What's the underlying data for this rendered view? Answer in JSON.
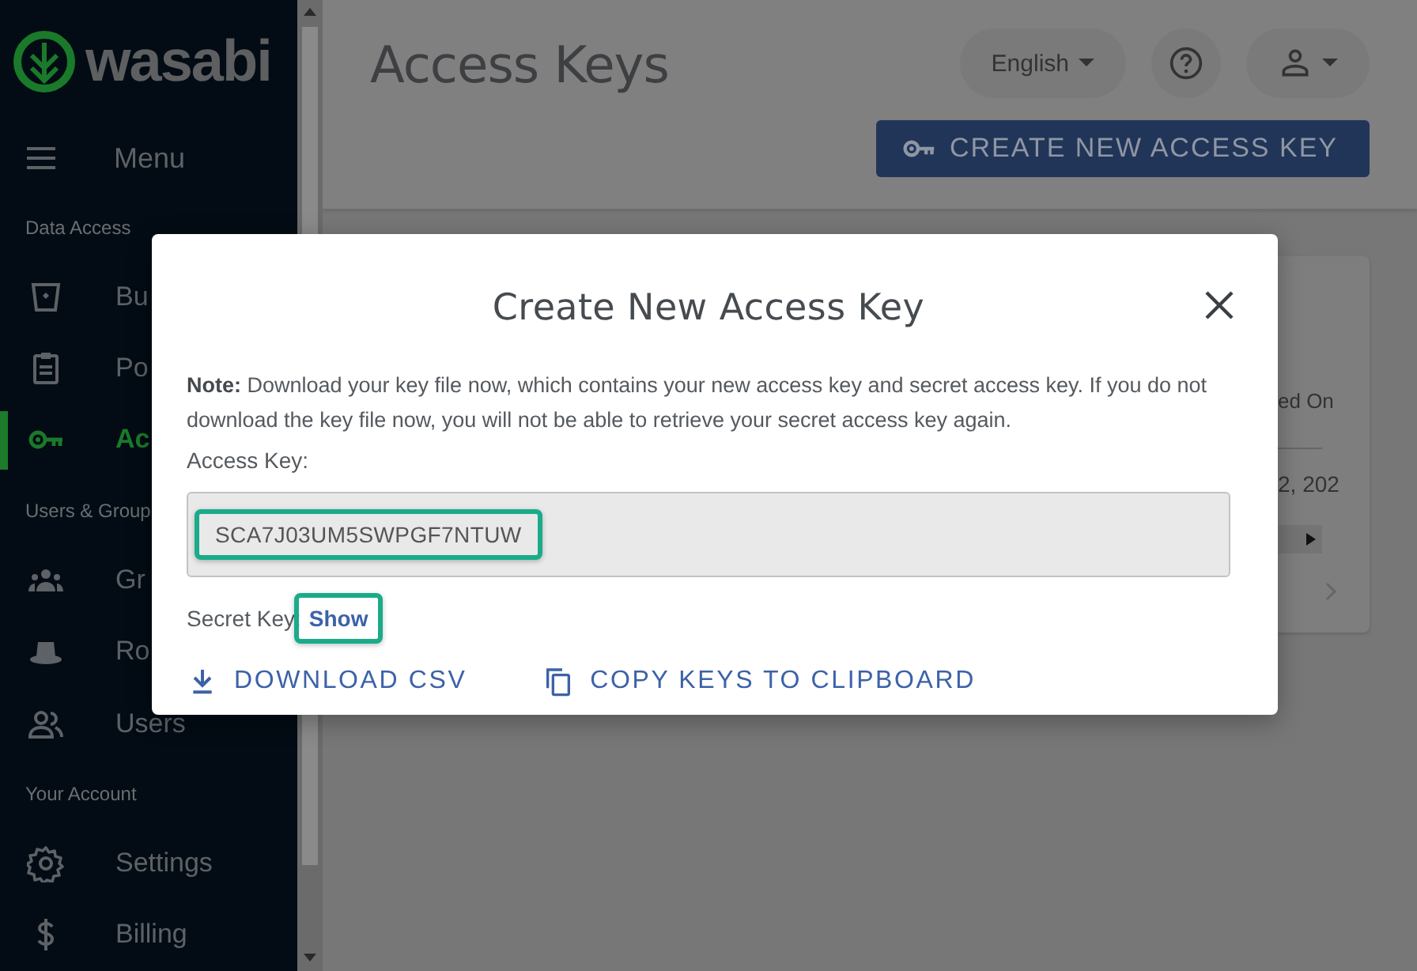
{
  "sidebar": {
    "logo": "wasabi",
    "menu_label": "Menu",
    "sections": [
      {
        "heading": "Data Access",
        "items": [
          {
            "label": "Bu",
            "kind": "bucket",
            "selected": false
          },
          {
            "label": "Po",
            "kind": "clipboard",
            "selected": false
          },
          {
            "label": "Ac",
            "kind": "key",
            "selected": true
          }
        ]
      },
      {
        "heading": "Users & Group",
        "items": [
          {
            "label": "Gr",
            "kind": "group",
            "selected": false
          },
          {
            "label": "Ro",
            "kind": "hat",
            "selected": false
          },
          {
            "label": "Users",
            "kind": "users",
            "selected": false
          }
        ]
      },
      {
        "heading": "Your Account",
        "items": [
          {
            "label": "Settings",
            "kind": "gear",
            "selected": false
          },
          {
            "label": "Billing",
            "kind": "dollar",
            "selected": false
          }
        ]
      }
    ]
  },
  "header": {
    "title": "Access Keys",
    "language": "English",
    "create_button": "CREATE NEW ACCESS KEY"
  },
  "table": {
    "column_3": "ed On",
    "cell": "2, 202"
  },
  "modal": {
    "title": "Create New Access Key",
    "note": "**Note:** Download your key file now, which contains your new access key and secret access key. If you do not download the key file now, you will not be able to retrieve your secret access key again.",
    "access_key_label": "Access Key:",
    "access_key": "SCA7J03UM5SWPGF7NTUW",
    "access_key_highlighted": true,
    "secret_key_label": "Secret Key:",
    "secret_key_action": "Show",
    "secret_action_highlighted": true,
    "actions": [
      {
        "label": "DOWNLOAD CSV",
        "kind": "download"
      },
      {
        "label": "COPY KEYS TO CLIPBOARD",
        "kind": "copy"
      }
    ]
  }
}
